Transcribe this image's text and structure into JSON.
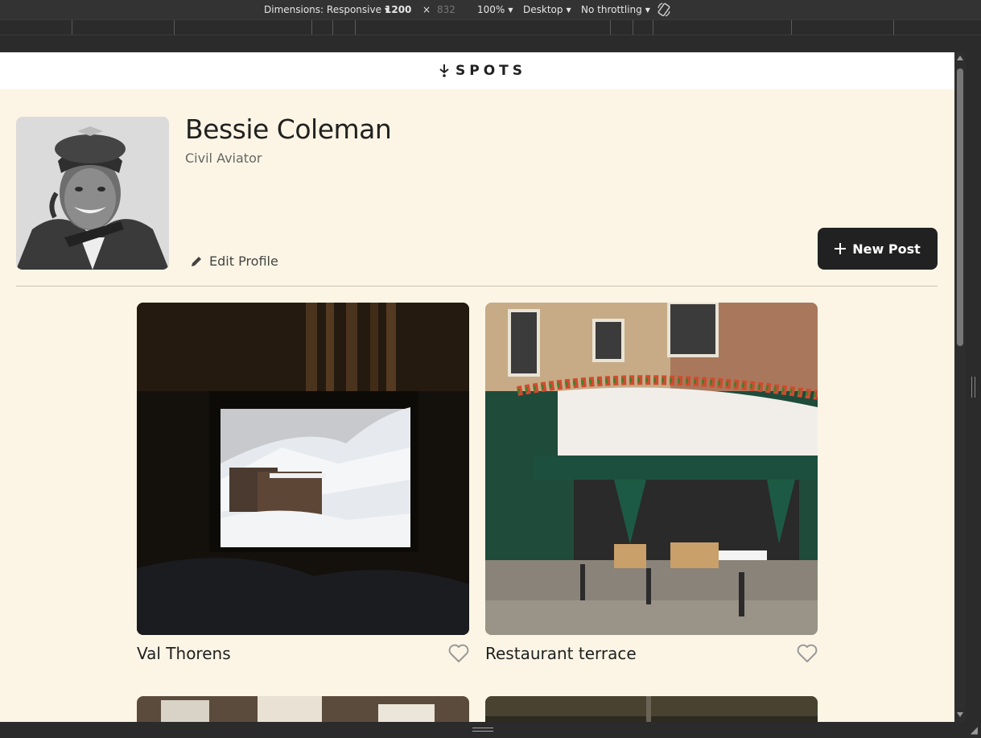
{
  "devtools": {
    "dimensions_label": "Dimensions: Responsive",
    "width": "1200",
    "times": "×",
    "height": "832",
    "zoom": "100%",
    "device": "Desktop",
    "throttling": "No throttling"
  },
  "header": {
    "logo_mark": "⚲",
    "logo_text": "SPOTS"
  },
  "profile": {
    "name": "Bessie Coleman",
    "title": "Civil Aviator",
    "edit_label": "Edit Profile",
    "new_post_label": "New Post"
  },
  "cards": [
    {
      "title": "Val Thorens",
      "liked": false
    },
    {
      "title": "Restaurant terrace",
      "liked": false
    }
  ],
  "icons": {
    "edit": "pencil-icon",
    "new_post": "plus-icon",
    "like": "heart-outline-icon",
    "rotate": "rotate-icon"
  },
  "colors": {
    "page_bg": "#fcf5e5",
    "button_bg": "#212121",
    "divider": "#c9bfb0"
  }
}
